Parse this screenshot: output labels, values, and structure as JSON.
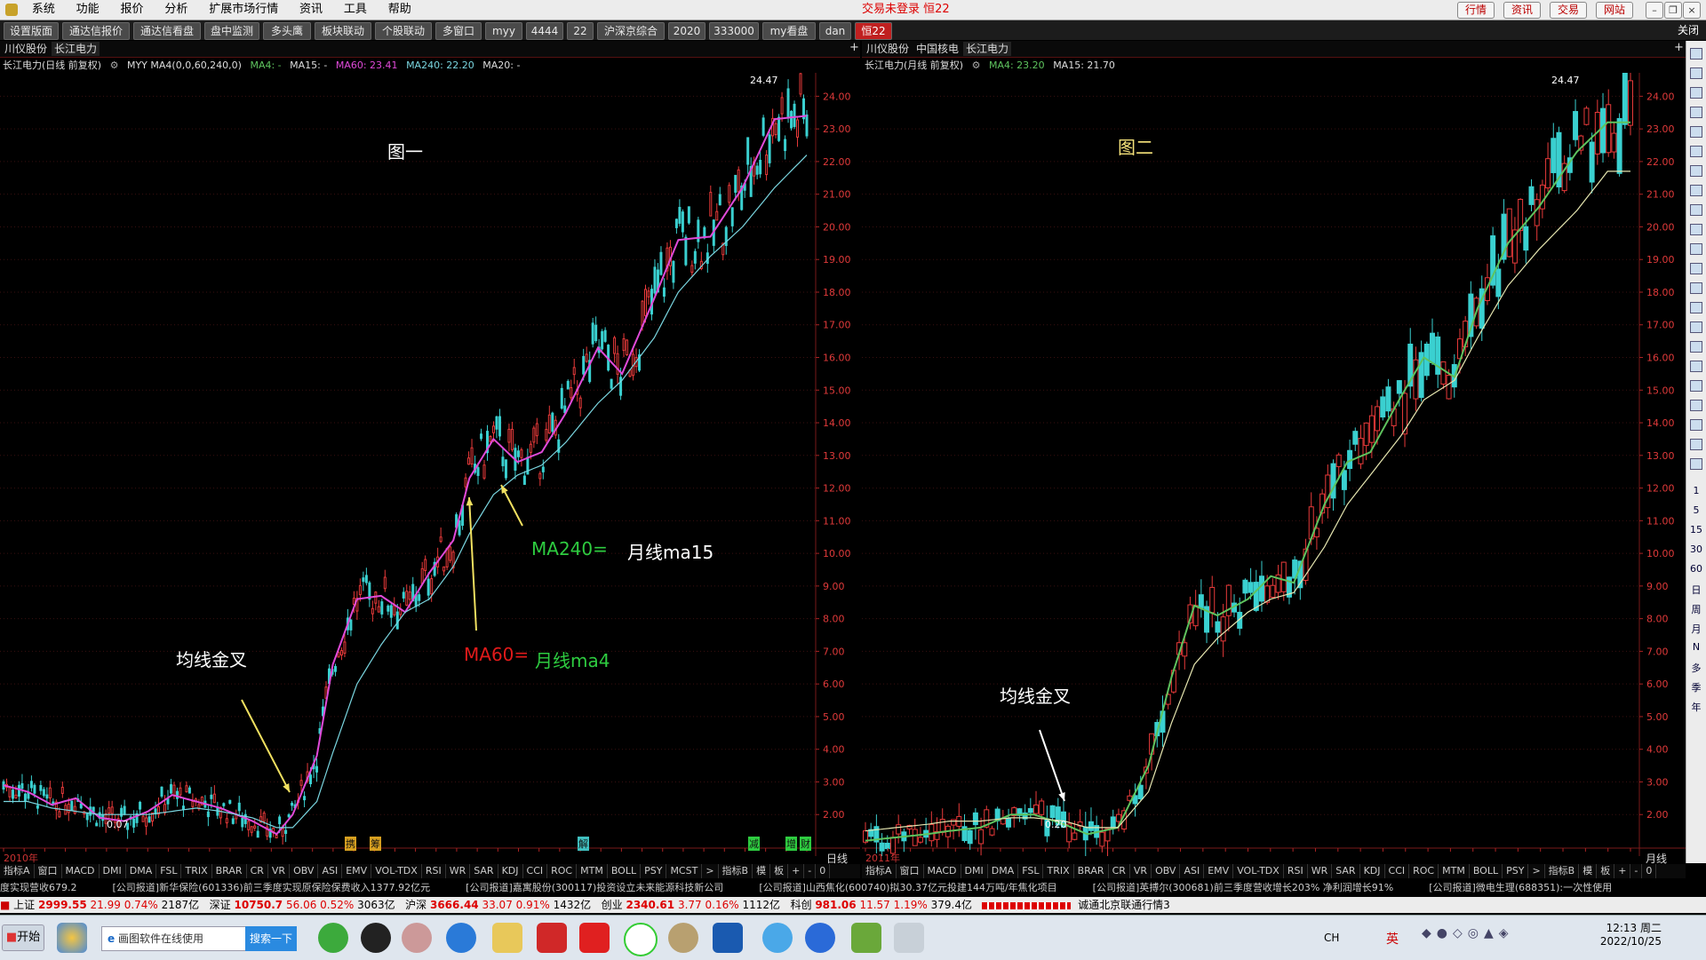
{
  "menu": {
    "items": [
      "系统",
      "功能",
      "报价",
      "分析",
      "扩展市场行情",
      "资讯",
      "工具",
      "帮助"
    ],
    "login_status": "交易未登录 恒22",
    "right_buttons": [
      "行情",
      "资讯",
      "交易",
      "网站"
    ]
  },
  "tabs": [
    "设置版面",
    "通达信报价",
    "通达信看盘",
    "盘中监测",
    "多头鹰",
    "板块联动",
    "个股联动",
    "多窗口",
    "myy",
    "4444",
    "22",
    "沪深京综合",
    "2020",
    "333000",
    "my看盘",
    "dan",
    "恒22"
  ],
  "tabs_close": "关闭",
  "left_panel": {
    "stock_tabs": [
      "川仪股份",
      "长江电力"
    ],
    "title": "长江电力(日线 前复权)",
    "indicator_name": "MYY MA4(0,0,60,240,0)",
    "ma_labels": [
      {
        "text": "MA4: -",
        "color": "#5ec35e"
      },
      {
        "text": "MA15: -",
        "color": "#dddddd"
      },
      {
        "text": "MA60: 23.41",
        "color": "#e04ad9"
      },
      {
        "text": "MA240: 22.20",
        "color": "#7ad6e0"
      },
      {
        "text": "MA20: -",
        "color": "#dddddd"
      }
    ],
    "chart_label": "图一",
    "annotations": {
      "golden_cross": "均线金叉",
      "ma240_key": "MA240=",
      "ma240_val": "月线ma15",
      "ma60_key": "MA60=",
      "ma60_val": "月线ma4"
    },
    "period_label": "日线",
    "year_label": "2010年",
    "peak_label": "24.47",
    "low_label": "0.07",
    "event_marks": [
      "携",
      "筹",
      "解",
      "减",
      "增",
      "财"
    ],
    "indicators": [
      "指标A",
      "窗口",
      "MACD",
      "DMI",
      "DMA",
      "FSL",
      "TRIX",
      "BRAR",
      "CR",
      "VR",
      "OBV",
      "ASI",
      "EMV",
      "VOL-TDX",
      "RSI",
      "WR",
      "SAR",
      "KDJ",
      "CCI",
      "ROC",
      "MTM",
      "BOLL",
      "PSY",
      "MCST",
      ">",
      "指标B",
      "模",
      "板",
      "+",
      "-",
      "0"
    ]
  },
  "right_panel": {
    "stock_tabs": [
      "川仪股份",
      "中国核电",
      "长江电力"
    ],
    "title": "长江电力(月线 前复权)",
    "ma_labels": [
      {
        "text": "MA4: 23.20",
        "color": "#5ec35e"
      },
      {
        "text": "MA15: 21.70",
        "color": "#dddddd"
      }
    ],
    "chart_label": "图二",
    "annotations": {
      "golden_cross": "均线金叉"
    },
    "period_label": "月线",
    "year_label": "2011年",
    "peak_label": "24.47",
    "low_label": "0.20",
    "indicators": [
      "指标A",
      "窗口",
      "MACD",
      "DMI",
      "DMA",
      "FSL",
      "TRIX",
      "BRAR",
      "CR",
      "VR",
      "OBV",
      "ASI",
      "EMV",
      "VOL-TDX",
      "RSI",
      "WR",
      "SAR",
      "KDJ",
      "CCI",
      "ROC",
      "MTM",
      "BOLL",
      "PSY",
      ">",
      "指标B",
      "模",
      "板",
      "+",
      "-",
      "0"
    ]
  },
  "chart_data": [
    {
      "type": "candlestick",
      "title": "长江电力(日线 前复权)",
      "yaxis_ticks": [
        "24.00",
        "23.00",
        "22.00",
        "21.00",
        "20.00",
        "19.00",
        "18.00",
        "17.00",
        "16.00",
        "15.00",
        "14.00",
        "13.00",
        "12.00",
        "11.00",
        "10.00",
        "9.00",
        "8.00",
        "7.00",
        "6.00",
        "5.00",
        "4.00",
        "3.00",
        "2.00"
      ],
      "ylim": [
        1.0,
        24.5
      ],
      "series": [
        {
          "name": "MA60",
          "color": "#e04ad9",
          "values": [
            2.9,
            2.7,
            2.3,
            2.5,
            1.9,
            1.8,
            2.1,
            2.6,
            2.4,
            2.2,
            1.8,
            1.4,
            2.0,
            3.8,
            6.6,
            8.6,
            8.7,
            8.2,
            9.4,
            10.4,
            12.3,
            13.5,
            12.8,
            13.1,
            14.3,
            16.3,
            15.5,
            17.8,
            19.6,
            19.7,
            21.2,
            23.3,
            23.4
          ]
        },
        {
          "name": "MA240",
          "color": "#7ad6e0",
          "values": [
            2.4,
            2.4,
            2.2,
            2.1,
            2.0,
            2.0,
            2.0,
            2.1,
            2.2,
            2.1,
            1.9,
            1.6,
            1.6,
            2.4,
            3.9,
            6.0,
            7.2,
            8.2,
            8.6,
            9.6,
            10.6,
            11.8,
            12.4,
            12.7,
            13.4,
            14.6,
            15.3,
            16.6,
            18.0,
            19.1,
            20.0,
            21.2,
            22.2
          ]
        }
      ],
      "x_positions": [
        0,
        0.03,
        0.06,
        0.09,
        0.12,
        0.15,
        0.18,
        0.21,
        0.24,
        0.27,
        0.31,
        0.34,
        0.36,
        0.39,
        0.41,
        0.44,
        0.47,
        0.5,
        0.53,
        0.56,
        0.58,
        0.61,
        0.64,
        0.67,
        0.7,
        0.74,
        0.77,
        0.81,
        0.84,
        0.88,
        0.92,
        0.96,
        1.0
      ],
      "candle_values": [
        2.8,
        2.4,
        2.1,
        2.6,
        1.8,
        2.0,
        2.3,
        2.7,
        2.2,
        2.0,
        1.7,
        1.5,
        2.4,
        4.5,
        7.3,
        9.5,
        8.4,
        8.9,
        10.0,
        11.3,
        12.9,
        13.3,
        12.5,
        13.5,
        15.0,
        17.0,
        15.2,
        18.4,
        19.8,
        20.6,
        22.3,
        23.8,
        23.0
      ],
      "peak": 24.47,
      "low": 0.07
    },
    {
      "type": "candlestick",
      "title": "长江电力(月线 前复权)",
      "yaxis_ticks": [
        "24.00",
        "23.00",
        "22.00",
        "21.00",
        "20.00",
        "19.00",
        "18.00",
        "17.00",
        "16.00",
        "15.00",
        "14.00",
        "13.00",
        "12.00",
        "11.00",
        "10.00",
        "9.00",
        "8.00",
        "7.00",
        "6.00",
        "5.00",
        "4.00",
        "3.00",
        "2.00"
      ],
      "ylim": [
        1.0,
        24.5
      ],
      "series": [
        {
          "name": "MA4",
          "color": "#5ec35e",
          "values": [
            1.2,
            1.3,
            1.4,
            1.5,
            1.6,
            2.0,
            2.0,
            1.7,
            1.4,
            1.6,
            3.5,
            6.2,
            8.4,
            8.1,
            8.6,
            9.3,
            9.1,
            11.5,
            12.8,
            13.1,
            14.8,
            16.0,
            15.4,
            17.5,
            19.5,
            20.6,
            22.3,
            23.2
          ]
        },
        {
          "name": "MA15",
          "color": "#e6e6b0",
          "values": [
            1.5,
            1.6,
            1.7,
            1.8,
            1.8,
            1.9,
            1.9,
            1.8,
            1.6,
            1.6,
            2.7,
            4.8,
            6.6,
            7.4,
            8.2,
            8.6,
            8.8,
            10.2,
            11.5,
            12.4,
            13.6,
            14.7,
            15.3,
            16.6,
            18.2,
            19.3,
            20.5,
            21.7
          ]
        }
      ],
      "x_positions": [
        0,
        0.04,
        0.08,
        0.11,
        0.15,
        0.19,
        0.22,
        0.26,
        0.29,
        0.33,
        0.37,
        0.4,
        0.43,
        0.46,
        0.5,
        0.53,
        0.56,
        0.6,
        0.63,
        0.66,
        0.7,
        0.73,
        0.77,
        0.8,
        0.84,
        0.88,
        0.93,
        0.97
      ],
      "peak": 24.47,
      "low": 0.2
    }
  ],
  "ticker": [
    "度实现营收679.2",
    "[公司报道]新华保险(601336)前三季度实现原保险保费收入1377.92亿元",
    "[公司报道]嘉寓股份(300117)投资设立未来能源科技新公司",
    "[公司报道]山西焦化(600740)拟30.37亿元投建144万吨/年焦化项目",
    "[公司报道]英搏尔(300681)前三季度营收增长203% 净利润增长91%",
    "[公司报道]微电生理(688351):一次性使用"
  ],
  "index_bar": {
    "sh": {
      "name": "上证",
      "val": "2999.55",
      "chg": "21.99",
      "pct": "0.74%",
      "amt": "2187亿"
    },
    "sz": {
      "name": "深证",
      "val": "10750.7",
      "chg": "56.06",
      "pct": "0.52%",
      "amt": "3063亿"
    },
    "hs": {
      "name": "沪深",
      "val": "3666.44",
      "chg": "33.07",
      "pct": "0.91%",
      "amt": "1432亿"
    },
    "cy": {
      "name": "创业",
      "val": "2340.61",
      "chg": "3.77",
      "pct": "0.16%",
      "amt": "1112亿"
    },
    "kc": {
      "name": "科创",
      "val": "981.06",
      "chg": "11.57",
      "pct": "1.19%",
      "amt": "379.4亿"
    },
    "feed": "诚通北京联通行情3"
  },
  "taskbar": {
    "start": "开始",
    "search_placeholder": "画图软件在线使用",
    "search_btn": "搜索一下",
    "ime": "CH",
    "ime_lang": "英",
    "time": "12:13 周二",
    "date": "2022/10/25"
  },
  "right_toolbar": [
    "1",
    "5",
    "15",
    "30",
    "60",
    "日",
    "周",
    "月",
    "N",
    "多",
    "季",
    "年"
  ]
}
